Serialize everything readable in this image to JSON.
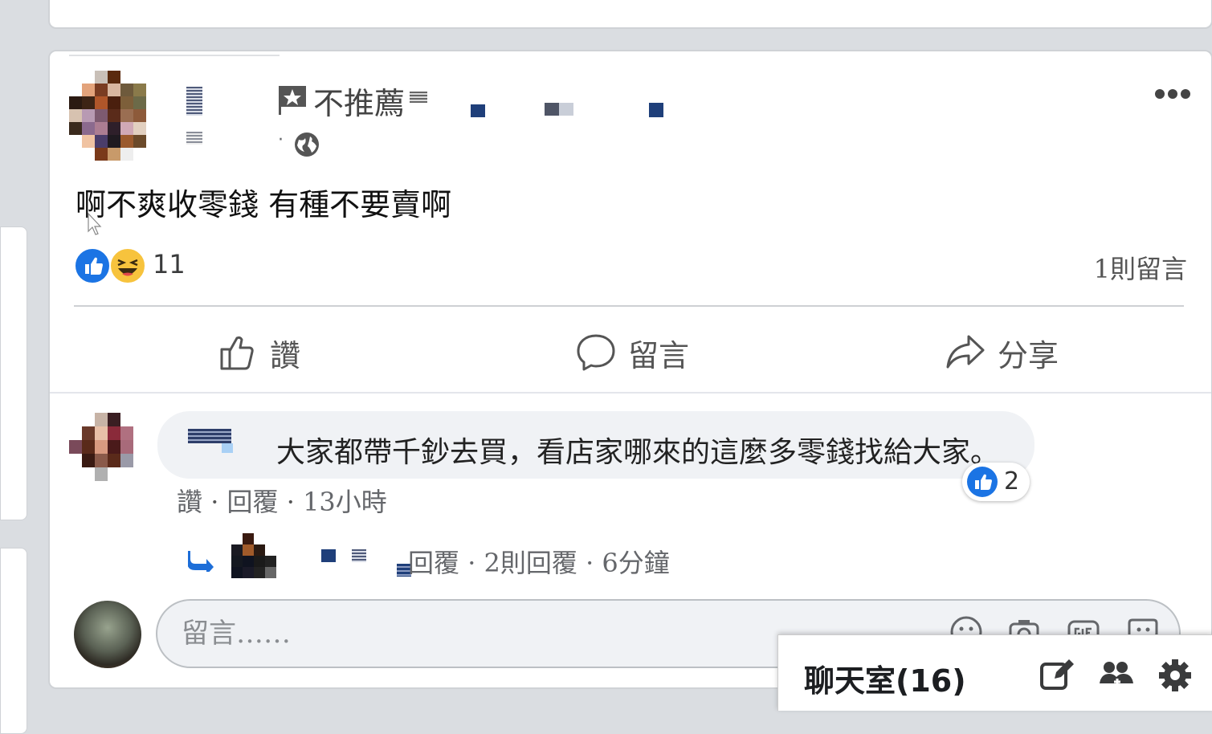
{
  "post": {
    "tag_label": "不推薦",
    "meta_dot": "·",
    "text": "啊不爽收零錢 有種不要賣啊",
    "reactions_count": "11",
    "comments_count": "1則留言"
  },
  "actions": {
    "like": "讚",
    "comment": "留言",
    "share": "分享"
  },
  "comment": {
    "text": "大家都帶千鈔去買，看店家哪來的這麼多零錢找給大家。",
    "reaction_count": "2",
    "like_link": "讚",
    "sep": " · ",
    "reply_link": "回覆",
    "time": "13小時",
    "reply_summary": {
      "reply_link": "回覆",
      "replies": "2則回覆",
      "time": "6分鐘"
    }
  },
  "composer": {
    "placeholder": "留言……"
  },
  "chat": {
    "label": "聊天室(16)"
  },
  "colors": {
    "accent": "#1b74e4",
    "haha": "#f7c33d",
    "background": "#dadde1"
  },
  "icons": [
    "flag-star-icon",
    "globe-icon",
    "more-icon",
    "like-icon",
    "comment-icon",
    "share-icon",
    "reply-arrow-icon",
    "emoji-icon",
    "camera-icon",
    "gif-icon",
    "sticker-icon",
    "compose-icon",
    "group-icon",
    "settings-icon",
    "cursor-icon"
  ]
}
